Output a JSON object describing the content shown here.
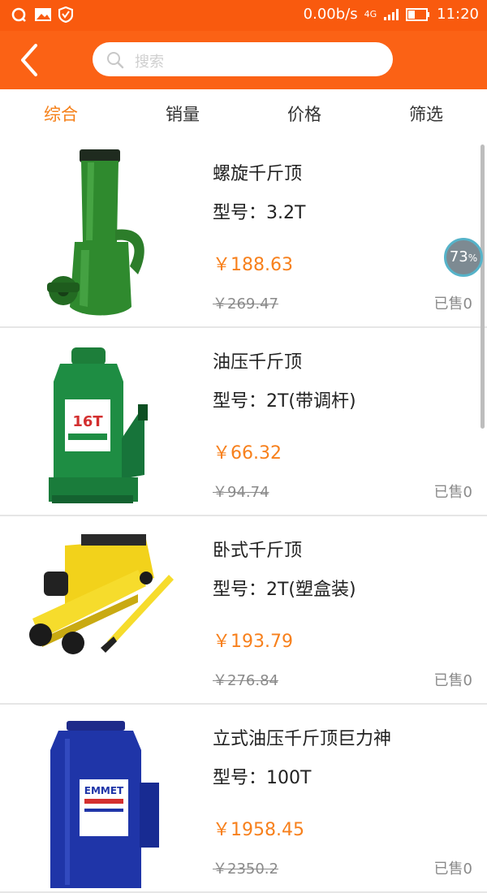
{
  "status_bar": {
    "speed": "0.00b/s",
    "network": "4G",
    "time": "11:20"
  },
  "header": {
    "search_placeholder": "搜索"
  },
  "tabs": [
    {
      "label": "综合",
      "active": true
    },
    {
      "label": "销量",
      "active": false
    },
    {
      "label": "价格",
      "active": false
    },
    {
      "label": "筛选",
      "active": false
    }
  ],
  "products": [
    {
      "name": "螺旋千斤顶",
      "model": "型号：3.2T",
      "price": "￥188.63",
      "original_price": "￥269.47",
      "sold": "已售0",
      "image": "screw-jack-icon"
    },
    {
      "name": "油压千斤顶",
      "model": "型号：2T(带调杆)",
      "price": "￥66.32",
      "original_price": "￥94.74",
      "sold": "已售0",
      "image": "hydraulic-bottle-jack-icon",
      "image_label": "16T"
    },
    {
      "name": "卧式千斤顶",
      "model": "型号：2T(塑盒装)",
      "price": "￥193.79",
      "original_price": "￥276.84",
      "sold": "已售0",
      "image": "floor-jack-icon"
    },
    {
      "name": "立式油压千斤顶巨力神",
      "model": "型号：100T",
      "price": "￥1958.45",
      "original_price": "￥2350.2",
      "sold": "已售0",
      "image": "vertical-hydraulic-jack-icon",
      "image_label": "EMMET"
    }
  ],
  "floating_badge": {
    "value": "73",
    "unit": "%"
  },
  "colors": {
    "accent": "#fb6215",
    "price": "#f7801c",
    "active_tab": "#f57f17"
  }
}
